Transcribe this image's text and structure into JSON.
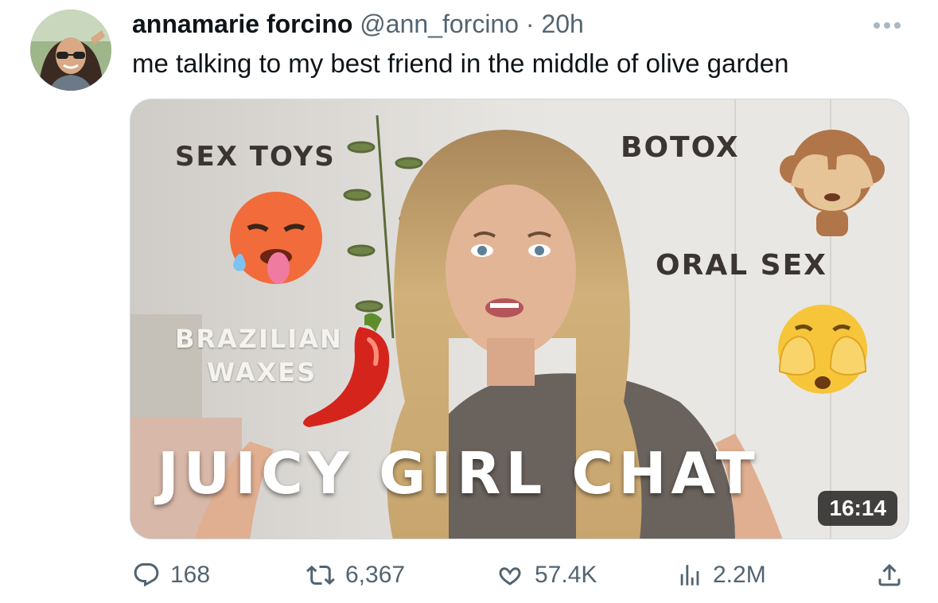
{
  "author": {
    "display_name": "annamarie forcino",
    "handle": "@ann_forcino",
    "separator": "·",
    "time": "20h"
  },
  "tweet": {
    "text": "me talking to my best friend in the middle of olive garden"
  },
  "media": {
    "overlay": {
      "sex_toys": "SEX TOYS",
      "botox": "BOTOX",
      "oral_sex": "ORAL SEX",
      "brazilian_line1": "BRAZILIAN",
      "brazilian_line2": "WAXES",
      "title": "JUICY GIRL CHAT"
    },
    "duration": "16:14",
    "emojis": [
      "hot-face-emoji",
      "see-no-evil-monkey-emoji",
      "face-with-hands-emoji",
      "hot-pepper-emoji"
    ]
  },
  "actions": {
    "replies": "168",
    "retweets": "6,367",
    "likes": "57.4K",
    "views": "2.2M"
  },
  "icons": {
    "reply": "reply-icon",
    "retweet": "retweet-icon",
    "like": "heart-icon",
    "views": "views-icon",
    "share": "share-icon",
    "more": "more-icon"
  },
  "colors": {
    "text_primary": "#0f1419",
    "text_secondary": "#536471"
  }
}
